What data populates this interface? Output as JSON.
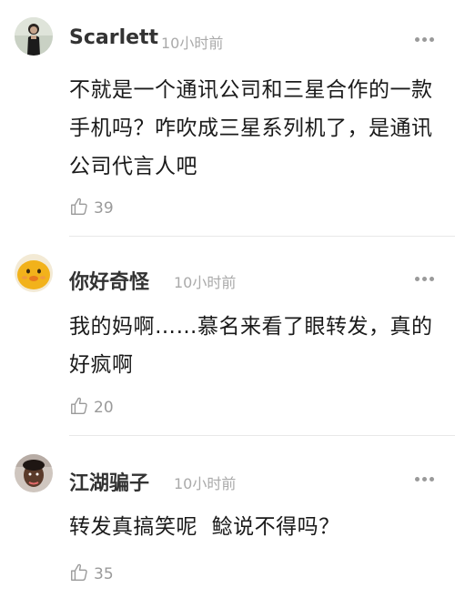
{
  "comments": [
    {
      "username": "Scarlett",
      "time": "10小时前",
      "text": "不就是一个通讯公司和三星合作的一款手机吗？咋吹成三星系列机了，是通讯公司代言人吧",
      "likes": "39",
      "avatar_icon": "woman-photo-avatar"
    },
    {
      "username": "你好奇怪",
      "time": "10小时前",
      "text": "我的妈啊……慕名来看了眼转发，真的好疯啊",
      "likes": "20",
      "avatar_icon": "yellow-duck-avatar"
    },
    {
      "username": "江湖骗子",
      "time": "10小时前",
      "text": "转发真搞笑呢  鲶说不得吗？",
      "likes": "35",
      "avatar_icon": "child-photo-avatar"
    }
  ],
  "colors": {
    "username": "#333333",
    "time": "#aaaaaa",
    "text": "#1a1a1a",
    "icon": "#9a9a9a",
    "divider": "#e8e8e8"
  }
}
